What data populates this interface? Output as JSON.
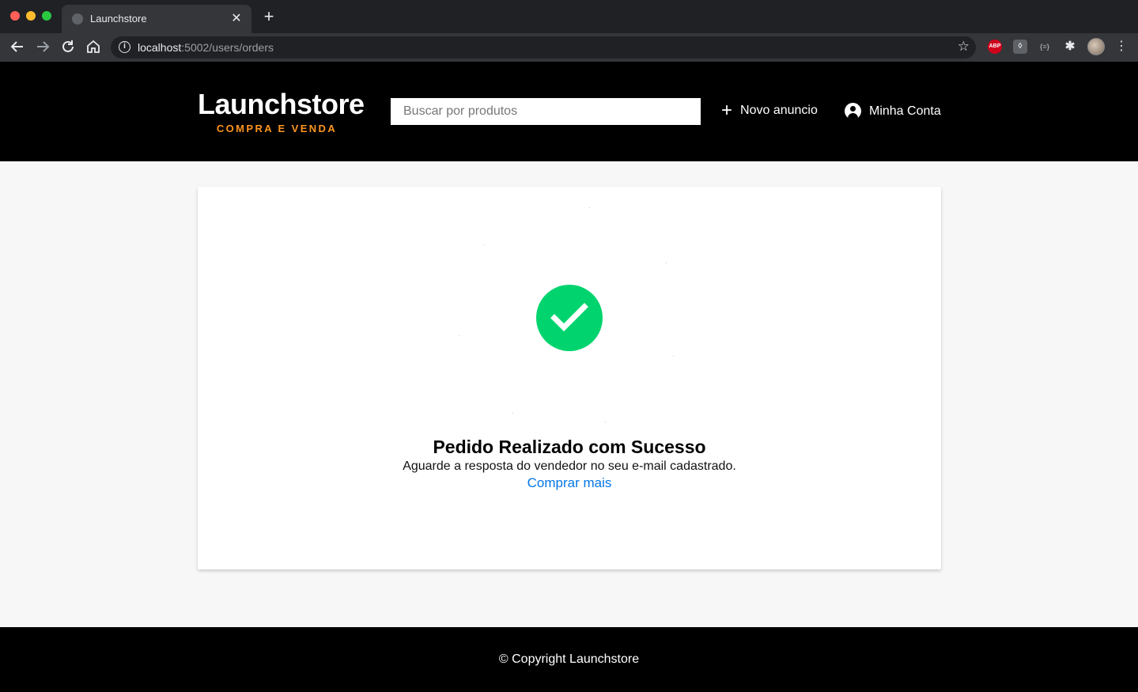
{
  "browser": {
    "tab_title": "Launchstore",
    "tab_close": "✕",
    "new_tab": "+",
    "url_host": "localhost",
    "url_rest": ":5002/users/orders",
    "ext_abp": "ABP"
  },
  "header": {
    "logo_title": "Launchstore",
    "logo_subtitle": "COMPRA E VENDA",
    "search_placeholder": "Buscar por produtos",
    "new_ad_label": "Novo anuncio",
    "account_label": "Minha Conta"
  },
  "main": {
    "title": "Pedido Realizado com Sucesso",
    "message": "Aguarde a resposta do vendedor no seu e-mail cadastrado.",
    "link_label": "Comprar mais"
  },
  "footer": {
    "copyright": "© Copyright Launchstore"
  },
  "colors": {
    "accent": "#fd951f",
    "success": "#01d46e",
    "link": "#0477e7"
  }
}
